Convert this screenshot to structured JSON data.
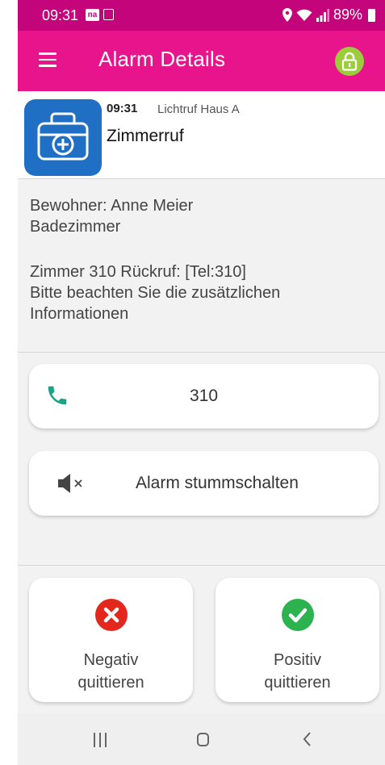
{
  "status_bar": {
    "time": "09:31",
    "notification_badge": "na",
    "battery": "89%"
  },
  "app_bar": {
    "title": "Alarm Details"
  },
  "alarm": {
    "time": "09:31",
    "source": "Lichtruf Haus A",
    "type": "Zimmerruf"
  },
  "details": {
    "resident": "Bewohner: Anne Meier",
    "location": "Badezimmer",
    "callback": "Zimmer 310 Rückruf: [Tel:310]",
    "note_line1": "Bitte beachten Sie die zusätzlichen",
    "note_line2": "Informationen"
  },
  "actions": {
    "call_number": "310",
    "mute_label": "Alarm stummschalten",
    "negative_line1": "Negativ",
    "negative_line2": "quittieren",
    "positive_line1": "Positiv",
    "positive_line2": "quittieren"
  },
  "colors": {
    "status_bar": "#c4047a",
    "app_bar": "#e8148c",
    "lock": "#9ccc3c",
    "medkit": "#1f6fc5",
    "phone_icon": "#1aa384",
    "negative": "#e3271c",
    "positive": "#2cb24e"
  },
  "icons": {
    "menu": "menu-icon",
    "lock": "lock-icon",
    "medkit": "medkit-icon",
    "phone": "phone-icon",
    "mute": "speaker-muted-icon",
    "negative": "x-circle-icon",
    "positive": "check-circle-icon"
  }
}
